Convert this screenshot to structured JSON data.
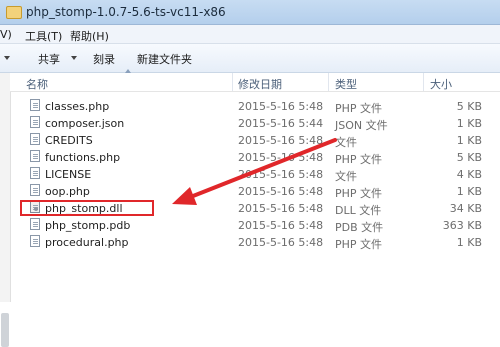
{
  "window": {
    "title": "php_stomp-1.0.7-5.6-ts-vc11-x86"
  },
  "menu": {
    "view_label": "V)",
    "tools_label": "工具(T)",
    "help_label": "帮助(H)"
  },
  "toolbar": {
    "share_label": "共享",
    "burn_label": "刻录",
    "new_folder_label": "新建文件夹"
  },
  "columns": {
    "name": "名称",
    "date": "修改日期",
    "type": "类型",
    "size": "大小"
  },
  "files": [
    {
      "name": "classes.php",
      "date": "2015-5-16 5:48",
      "type": "PHP 文件",
      "size": "5 KB"
    },
    {
      "name": "composer.json",
      "date": "2015-5-16 5:44",
      "type": "JSON 文件",
      "size": "1 KB"
    },
    {
      "name": "CREDITS",
      "date": "2015-5-16 5:48",
      "type": "文件",
      "size": "1 KB"
    },
    {
      "name": "functions.php",
      "date": "2015-5-16 5:48",
      "type": "PHP 文件",
      "size": "5 KB"
    },
    {
      "name": "LICENSE",
      "date": "2015-5-16 5:48",
      "type": "文件",
      "size": "4 KB"
    },
    {
      "name": "oop.php",
      "date": "2015-5-16 5:48",
      "type": "PHP 文件",
      "size": "1 KB"
    },
    {
      "name": "php_stomp.dll",
      "date": "2015-5-16 5:48",
      "type": "DLL 文件",
      "size": "34 KB"
    },
    {
      "name": "php_stomp.pdb",
      "date": "2015-5-16 5:48",
      "type": "PDB 文件",
      "size": "363 KB"
    },
    {
      "name": "procedural.php",
      "date": "2015-5-16 5:48",
      "type": "PHP 文件",
      "size": "1 KB"
    }
  ],
  "colors": {
    "highlight": "#e0272a"
  }
}
